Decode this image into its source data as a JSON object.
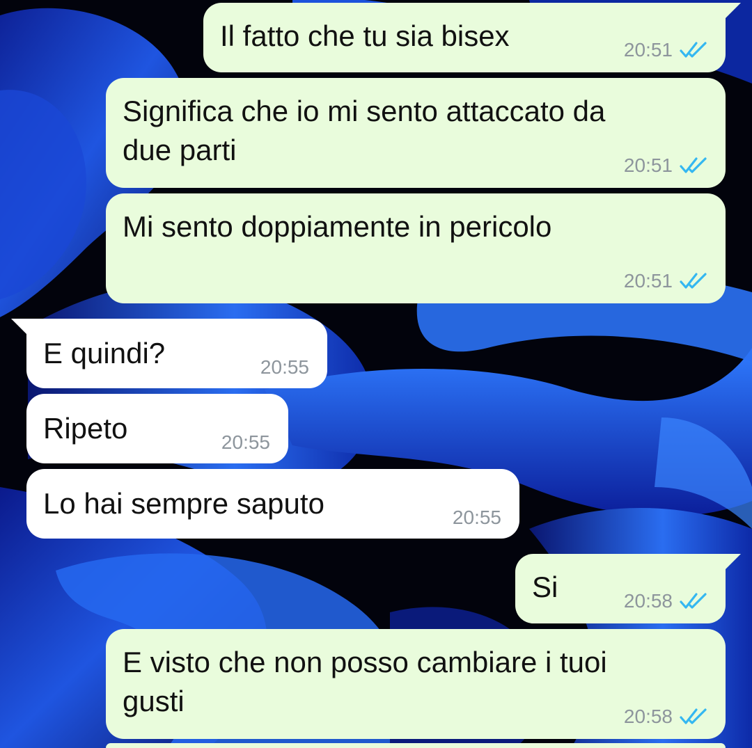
{
  "colors": {
    "outgoing_bubble": "#e9fcdc",
    "incoming_bubble": "#ffffff",
    "read_ticks": "#34b7f1",
    "timestamp": "#8d959c"
  },
  "messages": [
    {
      "direction": "outgoing",
      "text": "Il fatto che tu sia bisex",
      "time": "20:51",
      "status": "read-double-check-icon"
    },
    {
      "direction": "outgoing",
      "text": "Significa che io mi sento attaccato da\ndue parti",
      "time": "20:51",
      "status": "read-double-check-icon"
    },
    {
      "direction": "outgoing",
      "text": "Mi sento doppiamente in pericolo",
      "time": "20:51",
      "status": "read-double-check-icon"
    },
    {
      "direction": "incoming",
      "text": "E quindi?",
      "time": "20:55"
    },
    {
      "direction": "incoming",
      "text": "Ripeto",
      "time": "20:55"
    },
    {
      "direction": "incoming",
      "text": "Lo hai sempre saputo",
      "time": "20:55"
    },
    {
      "direction": "outgoing",
      "text": "Si",
      "time": "20:58",
      "status": "read-double-check-icon"
    },
    {
      "direction": "outgoing",
      "text": "E visto che non posso cambiare i tuoi\ngusti",
      "time": "20:58",
      "status": "read-double-check-icon"
    }
  ]
}
